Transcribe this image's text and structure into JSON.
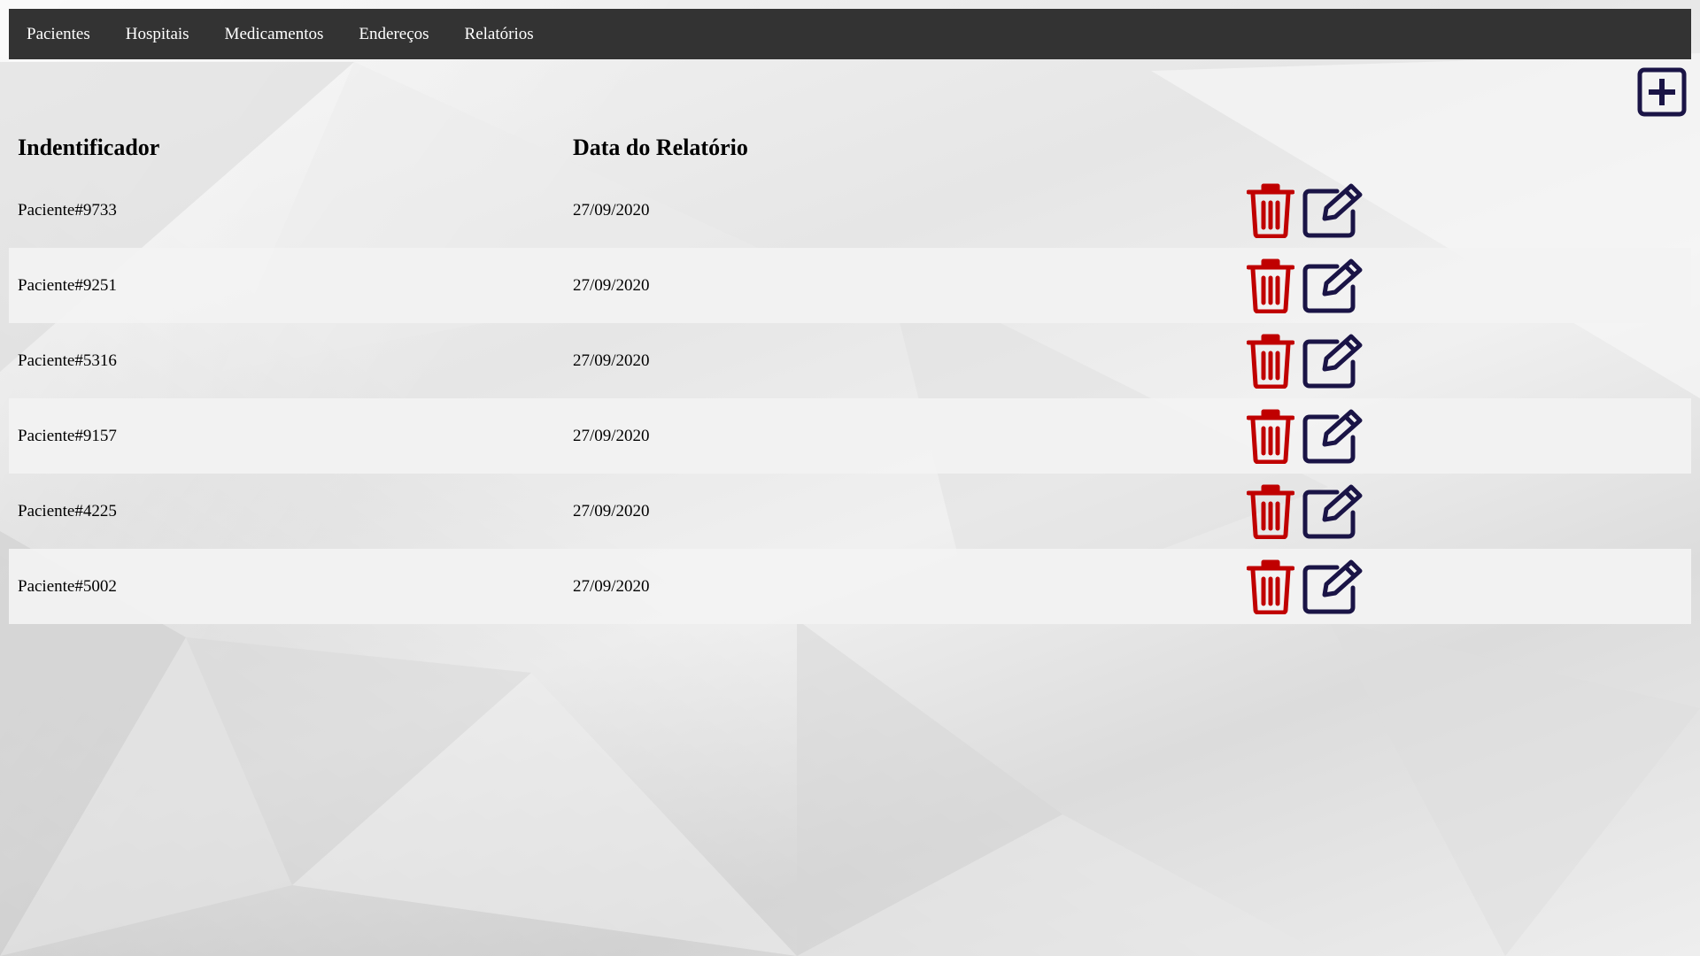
{
  "nav": {
    "items": [
      {
        "label": "Pacientes"
      },
      {
        "label": "Hospitais"
      },
      {
        "label": "Medicamentos"
      },
      {
        "label": "Endereços"
      },
      {
        "label": "Relatórios"
      }
    ]
  },
  "actions": {
    "add_icon": "plus-square-icon",
    "delete_icon": "trash-icon",
    "edit_icon": "edit-icon"
  },
  "colors": {
    "navbar": "#333333",
    "delete": "#c00000",
    "edit_add": "#1a1446"
  },
  "table": {
    "headers": {
      "id": "Indentificador",
      "date": "Data do Relatório"
    },
    "rows": [
      {
        "id": "Paciente#9733",
        "date": "27/09/2020"
      },
      {
        "id": "Paciente#9251",
        "date": "27/09/2020"
      },
      {
        "id": "Paciente#5316",
        "date": "27/09/2020"
      },
      {
        "id": "Paciente#9157",
        "date": "27/09/2020"
      },
      {
        "id": "Paciente#4225",
        "date": "27/09/2020"
      },
      {
        "id": "Paciente#5002",
        "date": "27/09/2020"
      }
    ]
  }
}
